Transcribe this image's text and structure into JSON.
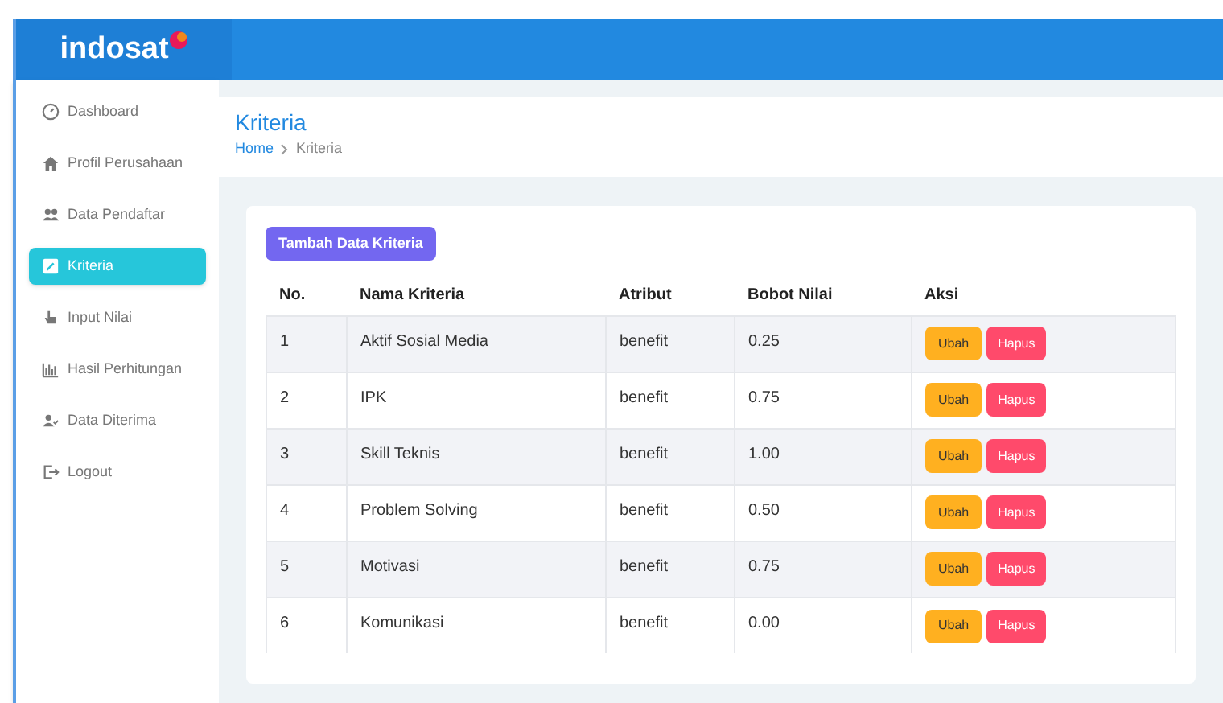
{
  "brand": {
    "name": "indosat"
  },
  "sidebar": {
    "items": [
      {
        "label": "Dashboard",
        "selected": false
      },
      {
        "label": "Profil Perusahaan",
        "selected": false
      },
      {
        "label": "Data Pendaftar",
        "selected": false
      },
      {
        "label": "Kriteria",
        "selected": true
      },
      {
        "label": "Input Nilai",
        "selected": false
      },
      {
        "label": "Hasil Perhitungan",
        "selected": false
      },
      {
        "label": "Data Diterima",
        "selected": false
      },
      {
        "label": "Logout",
        "selected": false
      }
    ]
  },
  "page": {
    "title": "Kriteria",
    "breadcrumb": [
      "Home",
      "Kriteria"
    ]
  },
  "add_button": "Tambah Data Kriteria",
  "table": {
    "columns": [
      "No.",
      "Nama Kriteria",
      "Atribut",
      "Bobot Nilai",
      "Aksi"
    ],
    "rows": [
      {
        "cells": [
          "1",
          "Aktif Sosial Media",
          "benefit",
          "0.25"
        ],
        "actions": [
          "Ubah",
          "Hapus"
        ]
      },
      {
        "cells": [
          "2",
          "IPK",
          "benefit",
          "0.75"
        ],
        "actions": [
          "Ubah",
          "Hapus"
        ]
      },
      {
        "cells": [
          "3",
          "Skill Teknis",
          "benefit",
          "1.00"
        ],
        "actions": [
          "Ubah",
          "Hapus"
        ]
      },
      {
        "cells": [
          "4",
          "Problem Solving",
          "benefit",
          "0.50"
        ],
        "actions": [
          "Ubah",
          "Hapus"
        ]
      },
      {
        "cells": [
          "5",
          "Motivasi",
          "benefit",
          "0.75"
        ],
        "actions": [
          "Ubah",
          "Hapus"
        ]
      },
      {
        "cells": [
          "6",
          "Komunikasi",
          "benefit",
          "0.00"
        ],
        "actions": [
          "Ubah",
          "Hapus"
        ]
      }
    ]
  }
}
